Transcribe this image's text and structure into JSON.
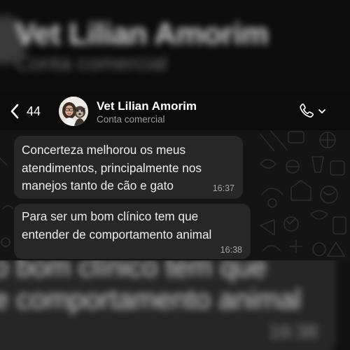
{
  "background_echo": {
    "name": "Vet Lilian Amorim",
    "subtitle": "Conta comercial",
    "message_line_1": "o bom clínico tem que",
    "message_line_2": "e comportamento animal",
    "time": "16:38"
  },
  "header": {
    "back_count": "44",
    "contact_name": "Vet Lilian Amorim",
    "contact_subtitle": "Conta comercial",
    "back_icon": "chevron-left-icon",
    "call_icon": "phone-icon",
    "call_menu_icon": "chevron-down-icon"
  },
  "messages": [
    {
      "text": "Concerteza melhorou os meus\natendimentos, principalmente nos\nmanejos tanto de cão e gato",
      "time": "16:37"
    },
    {
      "text": "Para ser um bom clínico tem que\nentender de comportamento animal",
      "time": "16:38"
    }
  ],
  "colors": {
    "background": "#111111",
    "header": "#0b0b0b",
    "chat_wallpaper": "#141414",
    "bubble": "#272727",
    "text": "#ededed",
    "secondary_text": "#9a9a9a"
  }
}
